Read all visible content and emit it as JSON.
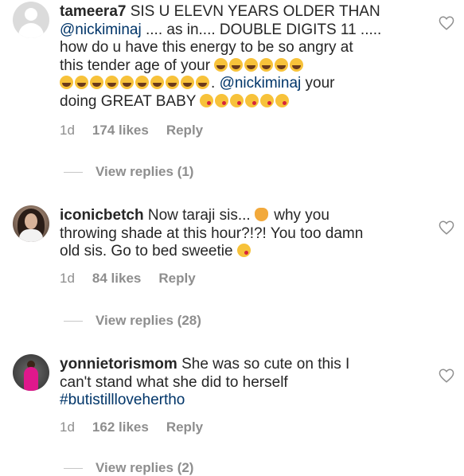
{
  "comments": [
    {
      "username": "tameera7",
      "text_line1": " SIS U ELEVN YEARS OLDER THAN",
      "mention1": "@nickiminaj",
      "text_line2": " .... as in.... DOUBLE DIGITS 11 .....",
      "text_line3": "how do u have this energy to be so angry at",
      "text_line4": "this tender age of your ",
      "text_line5_tail": ". ",
      "mention2": "@nickiminaj",
      "text_line5_end": " your",
      "text_line6": "doing GREAT BABY ",
      "age": "1d",
      "likes": "174 likes",
      "reply": "Reply",
      "view_replies": "View replies (1)"
    },
    {
      "username": "iconicbetch",
      "text_line1": " Now taraji sis... ",
      "text_line1_end": " why you",
      "text_line2": "throwing shade at this hour?!?! You too damn",
      "text_line3": "old sis. Go to bed sweetie ",
      "age": "1d",
      "likes": "84 likes",
      "reply": "Reply",
      "view_replies": "View replies (28)"
    },
    {
      "username": "yonnietorismom",
      "text_line1": " She was so cute on this I",
      "text_line2": "can't stand what she did to herself",
      "hashtag": "#butistilllovehertho",
      "age": "1d",
      "likes": "162 likes",
      "reply": "Reply",
      "view_replies": "View replies (2)"
    }
  ],
  "icons": {
    "like": "heart-outline-icon",
    "joy": "face-with-tears-of-joy-emoji",
    "kiss": "face-blowing-kiss-emoji",
    "cat": "cat-with-tears-of-joy-emoji"
  },
  "colors": {
    "text": "#262626",
    "mention": "#003569",
    "meta": "#8e8e8e"
  }
}
